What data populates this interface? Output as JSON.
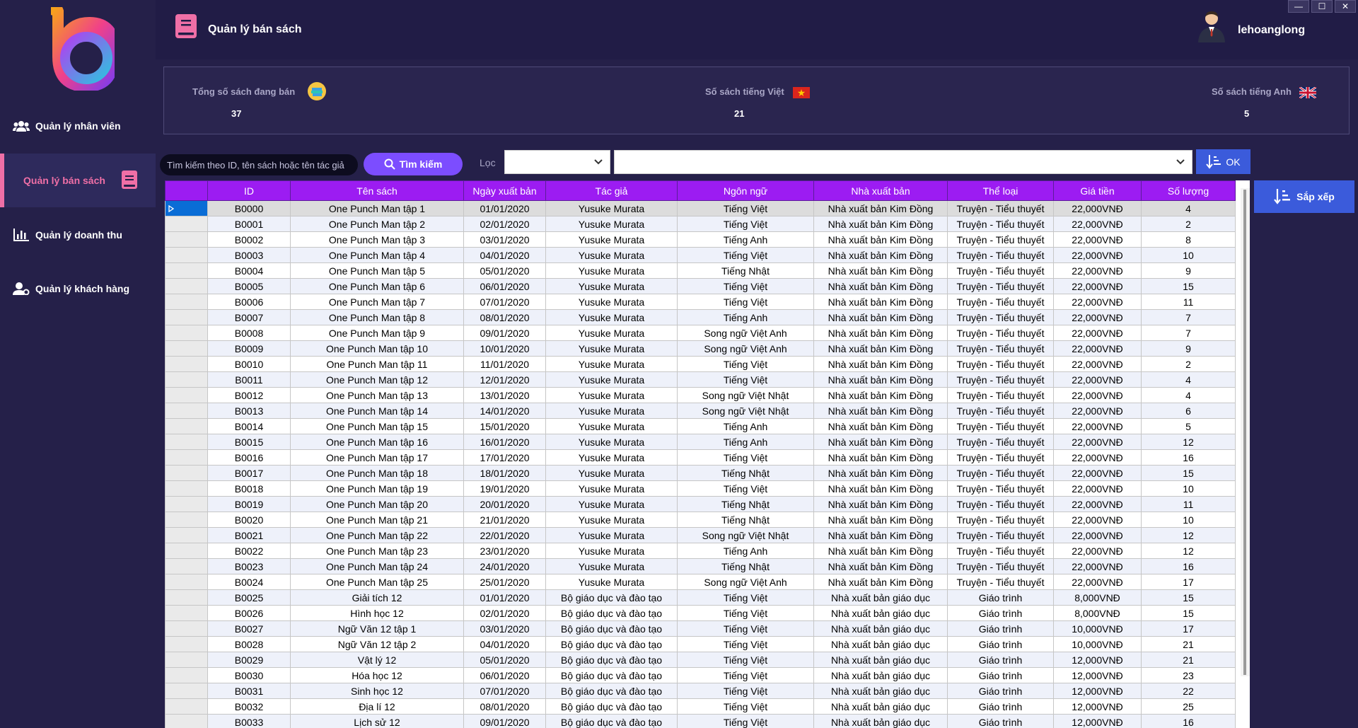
{
  "window": {
    "minimize_symbol": "—",
    "maximize_symbol": "☐",
    "close_symbol": "✕"
  },
  "sidebar": {
    "items": [
      {
        "label": "Quản lý nhân viên",
        "icon": "users-icon"
      },
      {
        "label": "Quản lý bán sách",
        "icon": "book-icon",
        "active": true
      },
      {
        "label": "Quản lý doanh thu",
        "icon": "bar-chart-icon"
      },
      {
        "label": "Quản lý khách hàng",
        "icon": "user-settings-icon"
      }
    ]
  },
  "header": {
    "title": "Quản lý bán sách",
    "username": "lehoanglong"
  },
  "stats": {
    "total_label": "Tổng số sách đang bán",
    "total_value": "37",
    "vietnamese_label": "Số sách tiếng Việt",
    "vietnamese_value": "21",
    "english_label": "Số sách tiếng Anh",
    "english_value": "5"
  },
  "search": {
    "placeholder": "Tìm kiếm theo ID, tên sách hoặc tên tác giả",
    "button_label": "Tìm kiếm"
  },
  "filter": {
    "label": "Lọc",
    "ok_label": "OK"
  },
  "sort_label": "Sắp xếp",
  "colors": {
    "bg": "#252049",
    "accent_pink": "#ef6fa6",
    "header_purple": "#9c1cf2",
    "button_purple": "#7c4dff",
    "button_blue": "#3b5bdb"
  },
  "table": {
    "columns": [
      "ID",
      "Tên sách",
      "Ngày xuất bản",
      "Tác giả",
      "Ngôn ngữ",
      "Nhà xuất bản",
      "Thể loại",
      "Giá tiền",
      "Số lượng"
    ],
    "rows": [
      [
        "B0000",
        "One Punch Man tập 1",
        "01/01/2020",
        "Yusuke Murata",
        "Tiếng Việt",
        "Nhà xuất bản Kim Đồng",
        "Truyện - Tiểu thuyết",
        "22,000VNĐ",
        "4"
      ],
      [
        "B0001",
        "One Punch Man tập 2",
        "02/01/2020",
        "Yusuke Murata",
        "Tiếng Việt",
        "Nhà xuất bản Kim Đồng",
        "Truyện - Tiểu thuyết",
        "22,000VNĐ",
        "2"
      ],
      [
        "B0002",
        "One Punch Man tập 3",
        "03/01/2020",
        "Yusuke Murata",
        "Tiếng Anh",
        "Nhà xuất bản Kim Đồng",
        "Truyện - Tiểu thuyết",
        "22,000VNĐ",
        "8"
      ],
      [
        "B0003",
        "One Punch Man tập 4",
        "04/01/2020",
        "Yusuke Murata",
        "Tiếng Việt",
        "Nhà xuất bản Kim Đồng",
        "Truyện - Tiểu thuyết",
        "22,000VNĐ",
        "10"
      ],
      [
        "B0004",
        "One Punch Man tập 5",
        "05/01/2020",
        "Yusuke Murata",
        "Tiếng Nhật",
        "Nhà xuất bản Kim Đồng",
        "Truyện - Tiểu thuyết",
        "22,000VNĐ",
        "9"
      ],
      [
        "B0005",
        "One Punch Man tập 6",
        "06/01/2020",
        "Yusuke Murata",
        "Tiếng Việt",
        "Nhà xuất bản Kim Đồng",
        "Truyện - Tiểu thuyết",
        "22,000VNĐ",
        "15"
      ],
      [
        "B0006",
        "One Punch Man tập 7",
        "07/01/2020",
        "Yusuke Murata",
        "Tiếng Việt",
        "Nhà xuất bản Kim Đồng",
        "Truyện - Tiểu thuyết",
        "22,000VNĐ",
        "11"
      ],
      [
        "B0007",
        "One Punch Man tập 8",
        "08/01/2020",
        "Yusuke Murata",
        "Tiếng Anh",
        "Nhà xuất bản Kim Đồng",
        "Truyện - Tiểu thuyết",
        "22,000VNĐ",
        "7"
      ],
      [
        "B0008",
        "One Punch Man tập 9",
        "09/01/2020",
        "Yusuke Murata",
        "Song ngữ Việt Anh",
        "Nhà xuất bản Kim Đồng",
        "Truyện - Tiểu thuyết",
        "22,000VNĐ",
        "7"
      ],
      [
        "B0009",
        "One Punch Man tập 10",
        "10/01/2020",
        "Yusuke Murata",
        "Song ngữ Việt Anh",
        "Nhà xuất bản Kim Đồng",
        "Truyện - Tiểu thuyết",
        "22,000VNĐ",
        "9"
      ],
      [
        "B0010",
        "One Punch Man tập 11",
        "11/01/2020",
        "Yusuke Murata",
        "Tiếng Việt",
        "Nhà xuất bản Kim Đồng",
        "Truyện - Tiểu thuyết",
        "22,000VNĐ",
        "2"
      ],
      [
        "B0011",
        "One Punch Man tập 12",
        "12/01/2020",
        "Yusuke Murata",
        "Tiếng Việt",
        "Nhà xuất bản Kim Đồng",
        "Truyện - Tiểu thuyết",
        "22,000VNĐ",
        "4"
      ],
      [
        "B0012",
        "One Punch Man tập 13",
        "13/01/2020",
        "Yusuke Murata",
        "Song ngữ Việt Nhật",
        "Nhà xuất bản Kim Đồng",
        "Truyện - Tiểu thuyết",
        "22,000VNĐ",
        "4"
      ],
      [
        "B0013",
        "One Punch Man tập 14",
        "14/01/2020",
        "Yusuke Murata",
        "Song ngữ Việt Nhật",
        "Nhà xuất bản Kim Đồng",
        "Truyện - Tiểu thuyết",
        "22,000VNĐ",
        "6"
      ],
      [
        "B0014",
        "One Punch Man tập 15",
        "15/01/2020",
        "Yusuke Murata",
        "Tiếng Anh",
        "Nhà xuất bản Kim Đồng",
        "Truyện - Tiểu thuyết",
        "22,000VNĐ",
        "5"
      ],
      [
        "B0015",
        "One Punch Man tập 16",
        "16/01/2020",
        "Yusuke Murata",
        "Tiếng Anh",
        "Nhà xuất bản Kim Đồng",
        "Truyện - Tiểu thuyết",
        "22,000VNĐ",
        "12"
      ],
      [
        "B0016",
        "One Punch Man tập 17",
        "17/01/2020",
        "Yusuke Murata",
        "Tiếng Việt",
        "Nhà xuất bản Kim Đồng",
        "Truyện - Tiểu thuyết",
        "22,000VNĐ",
        "16"
      ],
      [
        "B0017",
        "One Punch Man tập 18",
        "18/01/2020",
        "Yusuke Murata",
        "Tiếng Nhật",
        "Nhà xuất bản Kim Đồng",
        "Truyện - Tiểu thuyết",
        "22,000VNĐ",
        "15"
      ],
      [
        "B0018",
        "One Punch Man tập 19",
        "19/01/2020",
        "Yusuke Murata",
        "Tiếng Việt",
        "Nhà xuất bản Kim Đồng",
        "Truyện - Tiểu thuyết",
        "22,000VNĐ",
        "10"
      ],
      [
        "B0019",
        "One Punch Man tập 20",
        "20/01/2020",
        "Yusuke Murata",
        "Tiếng Nhật",
        "Nhà xuất bản Kim Đồng",
        "Truyện - Tiểu thuyết",
        "22,000VNĐ",
        "11"
      ],
      [
        "B0020",
        "One Punch Man tập 21",
        "21/01/2020",
        "Yusuke Murata",
        "Tiếng Nhật",
        "Nhà xuất bản Kim Đồng",
        "Truyện - Tiểu thuyết",
        "22,000VNĐ",
        "10"
      ],
      [
        "B0021",
        "One Punch Man tập 22",
        "22/01/2020",
        "Yusuke Murata",
        "Song ngữ Việt Nhật",
        "Nhà xuất bản Kim Đồng",
        "Truyện - Tiểu thuyết",
        "22,000VNĐ",
        "12"
      ],
      [
        "B0022",
        "One Punch Man tập 23",
        "23/01/2020",
        "Yusuke Murata",
        "Tiếng Anh",
        "Nhà xuất bản Kim Đồng",
        "Truyện - Tiểu thuyết",
        "22,000VNĐ",
        "12"
      ],
      [
        "B0023",
        "One Punch Man tập 24",
        "24/01/2020",
        "Yusuke Murata",
        "Tiếng Nhật",
        "Nhà xuất bản Kim Đồng",
        "Truyện - Tiểu thuyết",
        "22,000VNĐ",
        "16"
      ],
      [
        "B0024",
        "One Punch Man tập 25",
        "25/01/2020",
        "Yusuke Murata",
        "Song ngữ Việt Anh",
        "Nhà xuất bản Kim Đồng",
        "Truyện - Tiểu thuyết",
        "22,000VNĐ",
        "17"
      ],
      [
        "B0025",
        "Giải tích 12",
        "01/01/2020",
        "Bộ giáo dục và đào tạo",
        "Tiếng Việt",
        "Nhà xuất bản giáo dục",
        "Giáo trình",
        "8,000VNĐ",
        "15"
      ],
      [
        "B0026",
        "Hình học 12",
        "02/01/2020",
        "Bộ giáo dục và đào tạo",
        "Tiếng Việt",
        "Nhà xuất bản giáo dục",
        "Giáo trình",
        "8,000VNĐ",
        "15"
      ],
      [
        "B0027",
        "Ngữ Văn 12 tập 1",
        "03/01/2020",
        "Bộ giáo dục và đào tạo",
        "Tiếng Việt",
        "Nhà xuất bản giáo dục",
        "Giáo trình",
        "10,000VNĐ",
        "17"
      ],
      [
        "B0028",
        "Ngữ Văn 12 tập 2",
        "04/01/2020",
        "Bộ giáo dục và đào tạo",
        "Tiếng Việt",
        "Nhà xuất bản giáo dục",
        "Giáo trình",
        "10,000VNĐ",
        "21"
      ],
      [
        "B0029",
        "Vật lý 12",
        "05/01/2020",
        "Bộ giáo dục và đào tạo",
        "Tiếng Việt",
        "Nhà xuất bản giáo dục",
        "Giáo trình",
        "12,000VNĐ",
        "21"
      ],
      [
        "B0030",
        "Hóa học 12",
        "06/01/2020",
        "Bộ giáo dục và đào tạo",
        "Tiếng Việt",
        "Nhà xuất bản giáo dục",
        "Giáo trình",
        "12,000VNĐ",
        "23"
      ],
      [
        "B0031",
        "Sinh học 12",
        "07/01/2020",
        "Bộ giáo dục và đào tạo",
        "Tiếng Việt",
        "Nhà xuất bản giáo dục",
        "Giáo trình",
        "12,000VNĐ",
        "22"
      ],
      [
        "B0032",
        "Địa lí 12",
        "08/01/2020",
        "Bộ giáo dục và đào tạo",
        "Tiếng Việt",
        "Nhà xuất bản giáo dục",
        "Giáo trình",
        "12,000VNĐ",
        "25"
      ],
      [
        "B0033",
        "Lịch sử 12",
        "09/01/2020",
        "Bộ giáo dục và đào tạo",
        "Tiếng Việt",
        "Nhà xuất bản giáo dục",
        "Giáo trình",
        "12,000VNĐ",
        "16"
      ]
    ]
  }
}
